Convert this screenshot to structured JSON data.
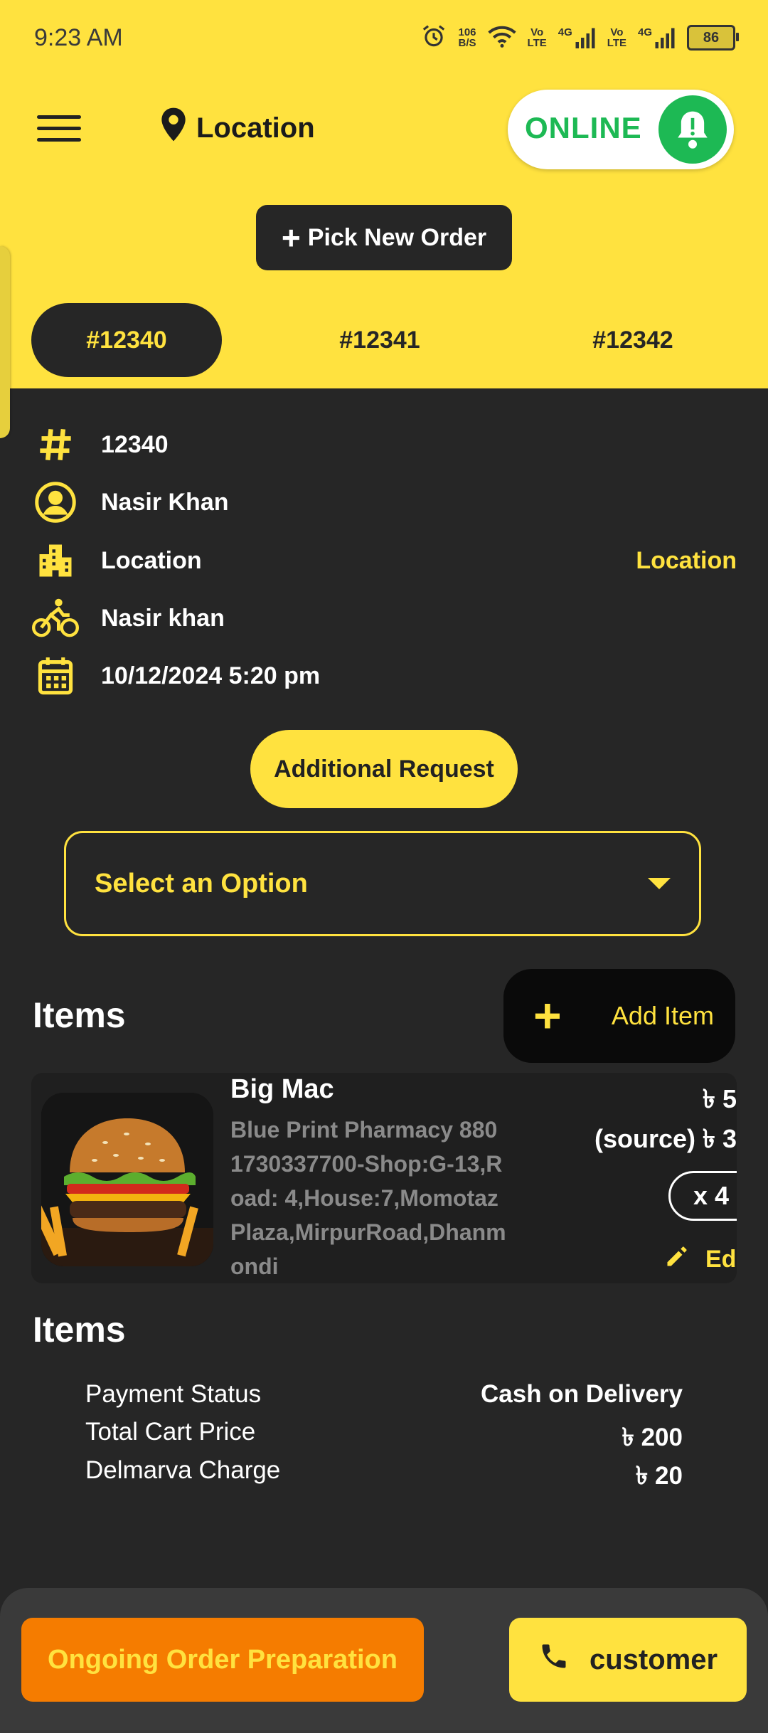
{
  "status_bar": {
    "time": "9:23 AM",
    "net_speed_value": "106",
    "net_speed_unit": "B/S",
    "sim1": {
      "vo": "Vo",
      "lte": "LTE",
      "gen": "4G"
    },
    "sim2": {
      "vo": "Vo",
      "lte": "LTE",
      "gen": "4G"
    },
    "battery": "86"
  },
  "header": {
    "location_label": "Location",
    "online_label": "ONLINE",
    "pick_order_label": "Pick New Order",
    "pick_order_plus": "+"
  },
  "tabs": [
    {
      "label": "#12340",
      "active": true
    },
    {
      "label": "#12341",
      "active": false
    },
    {
      "label": "#12342",
      "active": false
    }
  ],
  "order": {
    "id": "12340",
    "customer_name": "Nasir Khan",
    "location": "Location",
    "location_link": "Location",
    "rider": "Nasir khan",
    "datetime": "10/12/2024 5:20 pm"
  },
  "additional_request_label": "Additional Request",
  "select": {
    "selected": "Select an Option"
  },
  "items_section": {
    "title": "Items",
    "add_item_plus": "+",
    "add_item_label": "Add Item"
  },
  "item": {
    "name": "Big Mac",
    "description": "Blue Print Pharmacy 8801730337700-Shop:G-13,Road: 4,House:7,MomotazPlaza,MirpurRoad,Dhanmondi",
    "price": "৳ 5",
    "source_price": "(source) ৳ 3",
    "quantity": "x 4",
    "edit_label": "Edit"
  },
  "summary": {
    "title": "Items",
    "rows": [
      {
        "label": "Payment Status",
        "value": "Cash on Delivery"
      },
      {
        "label": "Total Cart Price",
        "value": "৳ 200"
      },
      {
        "label": "Delmarva Charge",
        "value": "৳ 20"
      }
    ]
  },
  "footer": {
    "ongoing_label": "Ongoing Order Preparation",
    "customer_label": "customer"
  },
  "colors": {
    "accent": "#FFE23F",
    "background": "#262626",
    "online_green": "#1DB954",
    "orange": "#F57C00"
  }
}
